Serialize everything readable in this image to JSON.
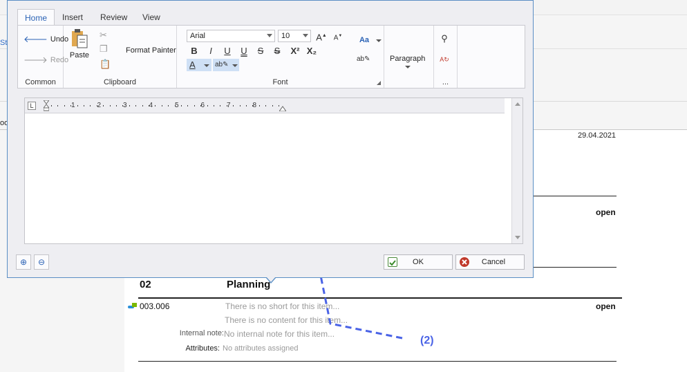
{
  "background": {
    "edge_text_1": "St",
    "edge_text_2": "oo",
    "date": "29.04.2021",
    "status_1": "open",
    "status_2": "open",
    "section_number": "02",
    "section_title": "Planning",
    "item_number": "003.006",
    "item_short": "There is no short for this item...",
    "item_content": "There is no content for this item...",
    "internal_note_label": "Internal note:",
    "internal_note_value": "No internal note for this item...",
    "attributes_label": "Attributes:",
    "attributes_value": "No attributes assigned"
  },
  "annotation": {
    "label": "(2)",
    "color": "#4a63e6"
  },
  "dialog": {
    "tabs": [
      {
        "label": "Home",
        "active": true
      },
      {
        "label": "Insert",
        "active": false
      },
      {
        "label": "Review",
        "active": false
      },
      {
        "label": "View",
        "active": false
      }
    ],
    "groups": {
      "common": {
        "label": "Common",
        "undo": "Undo",
        "redo": "Redo"
      },
      "clipboard": {
        "label": "Clipboard",
        "paste": "Paste",
        "format_painter": "Format Painter"
      },
      "font": {
        "label": "Font",
        "font_name": "Arial",
        "font_size": "10",
        "case_label": "Aa",
        "format_buttons": [
          "B",
          "I",
          "U",
          "U",
          "S",
          "S",
          "X²",
          "X₂"
        ]
      },
      "paragraph": {
        "label": "Paragraph"
      },
      "editing": {
        "label": "..."
      }
    },
    "ruler_numbers": [
      "1",
      "2",
      "3",
      "4",
      "5",
      "6",
      "7",
      "8"
    ],
    "buttons": {
      "ok": "OK",
      "cancel": "Cancel"
    },
    "colors": {
      "accent": "#2a62b5",
      "border": "#5a8ec4",
      "highlight": "#cfe0f5"
    }
  }
}
